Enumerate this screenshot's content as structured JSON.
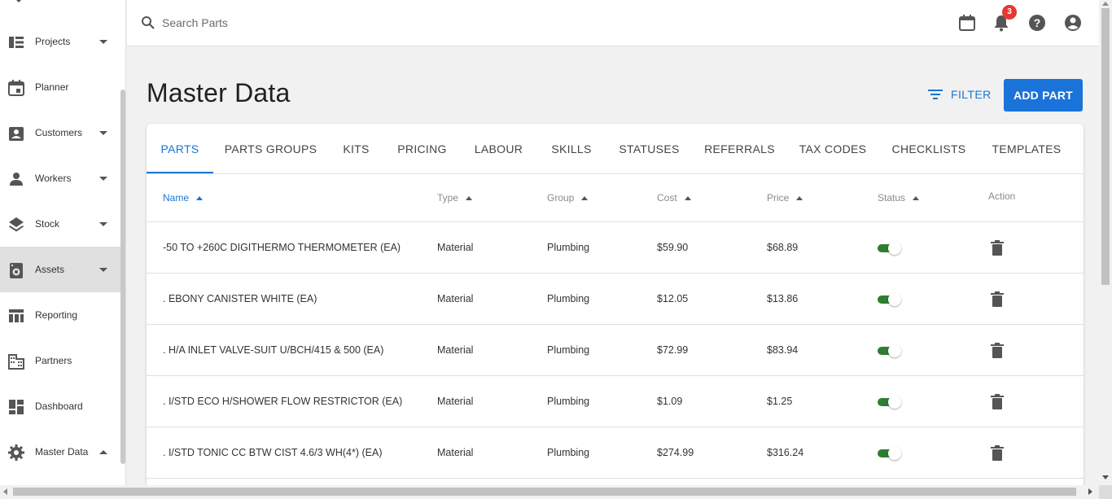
{
  "sidebar": {
    "items": [
      {
        "label": "Projects",
        "icon": "projects-icon",
        "caret": "down"
      },
      {
        "label": "Planner",
        "icon": "calendar-icon",
        "caret": ""
      },
      {
        "label": "Customers",
        "icon": "contact-card-icon",
        "caret": "down"
      },
      {
        "label": "Workers",
        "icon": "person-icon",
        "caret": "down"
      },
      {
        "label": "Stock",
        "icon": "layers-icon",
        "caret": "down"
      },
      {
        "label": "Assets",
        "icon": "washing-machine-icon",
        "caret": "down",
        "active": true
      },
      {
        "label": "Reporting",
        "icon": "table-icon",
        "caret": ""
      },
      {
        "label": "Partners",
        "icon": "building-icon",
        "caret": ""
      },
      {
        "label": "Dashboard",
        "icon": "dashboard-icon",
        "caret": ""
      },
      {
        "label": "Master Data",
        "icon": "gear-icon",
        "caret": "up"
      }
    ]
  },
  "header": {
    "search_placeholder": "Search Parts",
    "notification_count": "3"
  },
  "page": {
    "title": "Master Data",
    "filter_label": "FILTER",
    "add_label": "ADD PART"
  },
  "tabs": [
    "PARTS",
    "PARTS GROUPS",
    "KITS",
    "PRICING",
    "LABOUR",
    "SKILLS",
    "STATUSES",
    "REFERRALS",
    "TAX CODES",
    "CHECKLISTS",
    "TEMPLATES"
  ],
  "active_tab": "PARTS",
  "table": {
    "columns": [
      "Name",
      "Type",
      "Group",
      "Cost",
      "Price",
      "Status",
      "Action"
    ],
    "rows": [
      {
        "name": "-50 TO +260C DIGITHERMO THERMOMETER (EA)",
        "type": "Material",
        "group": "Plumbing",
        "cost": "$59.90",
        "price": "$68.89",
        "status": true
      },
      {
        "name": ". EBONY CANISTER WHITE (EA)",
        "type": "Material",
        "group": "Plumbing",
        "cost": "$12.05",
        "price": "$13.86",
        "status": true
      },
      {
        "name": ". H/A INLET VALVE-SUIT U/BCH/415 & 500 (EA)",
        "type": "Material",
        "group": "Plumbing",
        "cost": "$72.99",
        "price": "$83.94",
        "status": true
      },
      {
        "name": ". I/STD ECO H/SHOWER FLOW RESTRICTOR (EA)",
        "type": "Material",
        "group": "Plumbing",
        "cost": "$1.09",
        "price": "$1.25",
        "status": true
      },
      {
        "name": ". I/STD TONIC CC BTW CIST 4.6/3 WH(4*) (EA)",
        "type": "Material",
        "group": "Plumbing",
        "cost": "$274.99",
        "price": "$316.24",
        "status": true
      }
    ]
  },
  "colors": {
    "accent": "#1976d2",
    "button": "#1a73d9",
    "toggle_on": "#2e7d32",
    "badge": "#e53935"
  }
}
